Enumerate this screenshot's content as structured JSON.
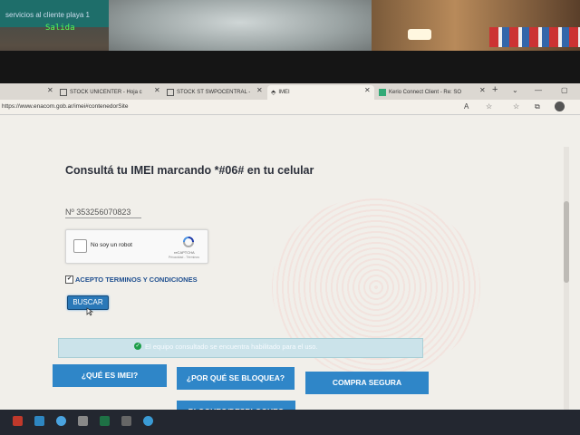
{
  "room": {
    "sign_text": "servicios al cliente  playa 1",
    "green_sign": "Salida"
  },
  "tabs": [
    {
      "label": "STOCK UNICENTER - Hoja c"
    },
    {
      "label": "STOCK ST SWPOCENTRAL -"
    },
    {
      "label": "IMEI"
    },
    {
      "label": "Kerio Connect Client - Re: SO"
    }
  ],
  "browser": {
    "url": "https://www.enacom.gob.ar/imei#contenedorSite",
    "new_tab": "+"
  },
  "page": {
    "heading": "Consultá tu IMEI marcando *#06# en tu celular",
    "imei_value": "Nº 353256070823",
    "recaptcha": {
      "label": "No soy un robot",
      "brand": "reCAPTCHA",
      "terms": "Privacidad - Términos"
    },
    "terms_label": "ACEPTO TERMINOS Y CONDICIONES",
    "search_button": "BUSCAR",
    "alert": "El equipo consultado se encuentra habilitado para el uso.",
    "buttons": {
      "what_is": "¿QUÉ ES IMEI?",
      "why_blocked": "¿POR QUÉ SE BLOQUEA?",
      "safe_purchase": "COMPRA SEGURA",
      "block_unblock": "BLOQUEO/DESBLOQUEO"
    }
  },
  "colors": {
    "primary_button": "#2f86c8",
    "alert_bg": "#cbe3ea",
    "heading": "#2b2f3a",
    "link": "#1f4f8f"
  }
}
